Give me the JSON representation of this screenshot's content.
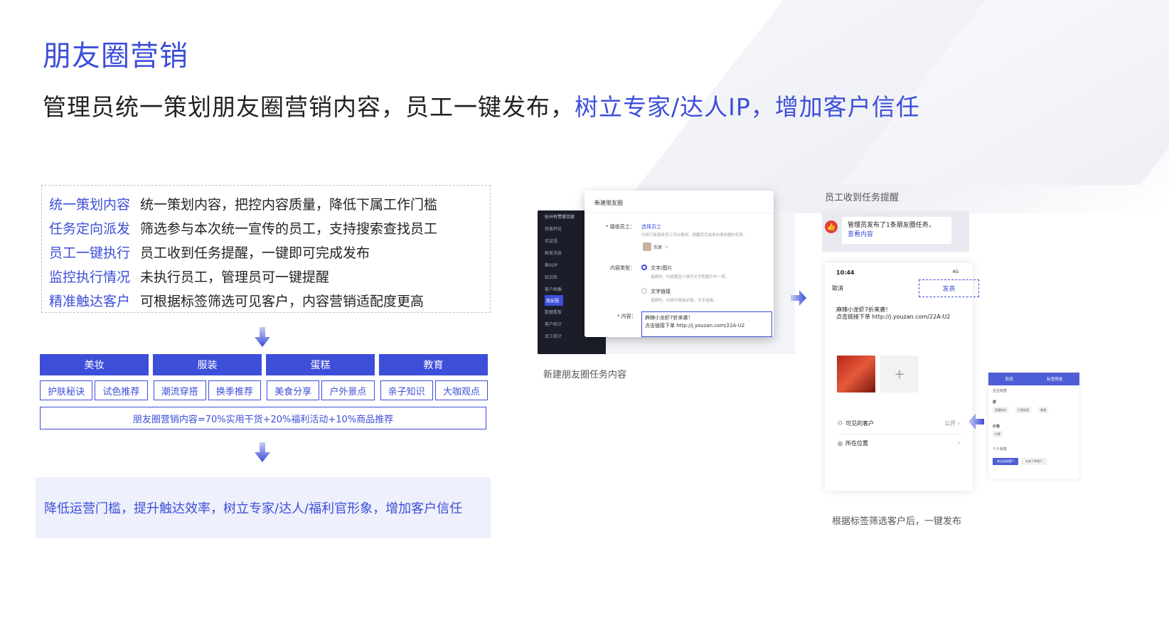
{
  "title": "朋友圈营销",
  "subtitle": {
    "part1": "管理员统一策划朋友圈营销内容，员工一键发布，",
    "part2": "树立专家/达人IP，增加客户信任"
  },
  "features": [
    {
      "key": "统一策划内容",
      "value": "统一策划内容，把控内容质量，降低下属工作门槛"
    },
    {
      "key": "任务定向派发",
      "value": "筛选参与本次统一宣传的员工，支持搜索查找员工"
    },
    {
      "key": "员工一键执行",
      "value": "员工收到任务提醒，一键即可完成发布"
    },
    {
      "key": "监控执行情况",
      "value": "未执行员工，管理员可一键提醒"
    },
    {
      "key": "精准触达客户",
      "value": "可根据标签筛选可见客户，内容营销适配度更高"
    }
  ],
  "categories": [
    "美妆",
    "服装",
    "蛋糕",
    "教育"
  ],
  "tags": [
    "护肤秘诀",
    "试色推荐",
    "潮流穿搭",
    "换季推荐",
    "美食分享",
    "户外景点",
    "亲子知识",
    "大咖观点"
  ],
  "formula": "朋友圈营销内容=70%实用干货+20%福利活动+10%商品推荐",
  "summary": "降低运营门槛，提升触达效率，树立专家/达人/福利官形象，增加客户信任",
  "admin": {
    "company": "杭州有赞餐饮部",
    "sidebar": [
      "获客转化",
      "欢迎语",
      "群发消息",
      "群SOP",
      "知识库",
      "客户画像",
      "朋友圈",
      "数据看板",
      "客户统计",
      "员工统计"
    ],
    "modal": {
      "title": "新建朋友圈",
      "receiver_label": "* 接收员工：",
      "select_link": "选择员工",
      "receiver_hint": "内容只有接收员工可以看到，提醒其完成发布朋友圈的任务。",
      "employee_chip": "灰原",
      "content_type_label": "内容类型：",
      "option1": "文字/图片",
      "option1_hint": "选择时，内容需至少填写文字和图片中一项。",
      "option2": "文字链接",
      "option2_hint": "选择时，内容中链接必填，文字选填。",
      "content_label": "* 内容：",
      "content_line1": "麻辣小龙虾7折来袭！",
      "content_line2": "点击链接下单 http://j.youzan.com/22A-U2"
    }
  },
  "caption_admin": "新建朋友圈任务内容",
  "notif_label": "员工收到任务提醒",
  "notif": {
    "line1": "管理员发布了1条朋友圈任务，",
    "link": "查看内容"
  },
  "phone": {
    "time": "10:44",
    "signal": "4G",
    "cancel": "取消",
    "publish": "发表",
    "text1": "麻辣小龙虾7折来袭！",
    "text2": "点击链接下单 http://j.youzan.com/22A-U2",
    "visible_label": "可见的客户",
    "visible_value": "公开",
    "location_label": "所在位置"
  },
  "filter": {
    "cancel": "取消",
    "title": "标签筛选",
    "group1": "企业标签",
    "group1_sub": "群",
    "chips1": [
      "直播粉丝",
      "日常促销",
      "普通"
    ],
    "group2": "价格",
    "chips2": [
      "中等"
    ],
    "group3": "个人标签",
    "btn1": "来自这群客户",
    "btn2": "未来下单客户"
  },
  "caption_phone": "根据标签筛选客户后，一键发布",
  "colors": {
    "accent": "#3d4ed9",
    "summary_bg": "#eef0fb"
  }
}
